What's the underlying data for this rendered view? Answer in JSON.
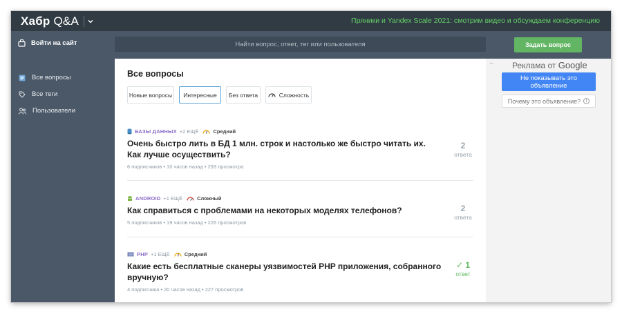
{
  "header": {
    "logo_main": "Хабр",
    "logo_sub": "Q&A",
    "promo_text": "Пряники и Yandex Scale 2021: смотрим видео и обсуждаем конференцию"
  },
  "subbar": {
    "login_label": "Войти на сайт",
    "search_placeholder": "Найти вопрос, ответ, тег или пользователя",
    "ask_button": "Задать вопрос"
  },
  "sidebar": {
    "items": [
      {
        "label": "Все вопросы",
        "icon": "list-icon"
      },
      {
        "label": "Все теги",
        "icon": "tag-icon"
      },
      {
        "label": "Пользователи",
        "icon": "users-icon"
      }
    ]
  },
  "main": {
    "title": "Все вопросы",
    "tabs": [
      {
        "label": "Новые вопросы",
        "active": false
      },
      {
        "label": "Интересные",
        "active": true
      },
      {
        "label": "Без ответа",
        "active": false
      },
      {
        "label": "Сложность",
        "active": false,
        "icon": "gauge-icon"
      }
    ],
    "questions": [
      {
        "tag": "БАЗЫ ДАННЫХ",
        "tag_icon": "database-icon",
        "more_tags": "+2 ЕЩЁ",
        "difficulty": "Средний",
        "title": "Очень быстро лить в БД 1 млн. строк и настолько же быстро читать их. Как лучше осуществить?",
        "stats": "6 подписчиков • 10 часов назад • 293 просмотра",
        "answer_count": "2",
        "answer_label": "ответа",
        "solved": false
      },
      {
        "tag": "ANDROID",
        "tag_icon": "android-icon",
        "more_tags": "+1 ЕЩЁ",
        "difficulty": "Сложный",
        "title": "Как справиться с проблемами на некоторых моделях телефонов?",
        "stats": "5 подписчиков • 19 часов назад • 226 просмотров",
        "answer_count": "2",
        "answer_label": "ответа",
        "solved": false
      },
      {
        "tag": "PHP",
        "tag_icon": "php-icon",
        "more_tags": "+1 ЕЩЁ",
        "difficulty": "Средний",
        "title": "Какие есть бесплатные сканеры уязвимостей PHP приложения, собранного вручную?",
        "stats": "4 подписчика • 20 часов назад • 227 просмотров",
        "answer_count": "✓ 1",
        "answer_label": "ответ",
        "solved": true
      }
    ]
  },
  "ad": {
    "arrow": "←",
    "header_prefix": "Реклама от",
    "header_brand": "Google",
    "hide_button": "Не показывать это объявление",
    "why_button": "Почему это объявление?",
    "info_glyph": "i"
  },
  "colors": {
    "topbar": "#303b44",
    "sidebar": "#4b5867",
    "accent_green": "#61b563",
    "promo_green": "#65d065",
    "tag_purple": "#8a6cc8",
    "ad_blue": "#4285f4"
  }
}
